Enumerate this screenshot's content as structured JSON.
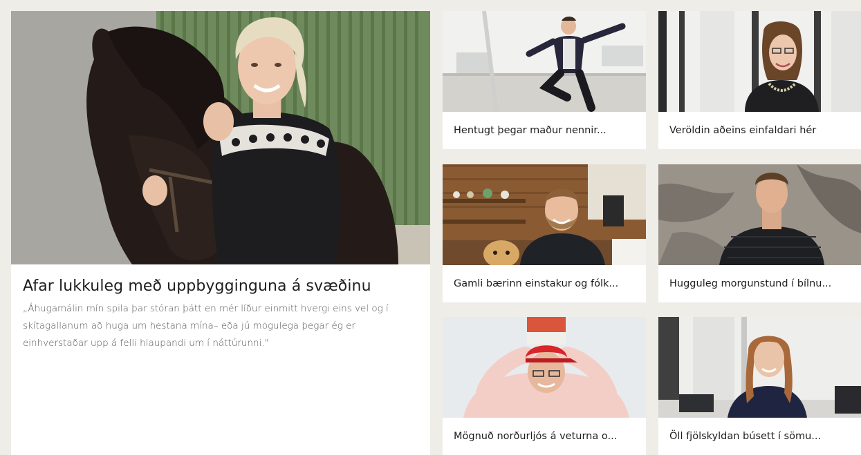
{
  "feature": {
    "title": "Afar lukkuleg með uppbygginguna á svæðinu",
    "quote": "„Áhugamálin mín spila þar stóran þátt en mér líður einmitt hvergi eins vel og í skítagallanum að huga um hestana mína– eða jú mögulega þegar ég er einhverstaðar upp á felli hlaupandi um í náttúrunni.\""
  },
  "cards": [
    {
      "title": "Hentugt þegar maður nennir..."
    },
    {
      "title": "Veröldin aðeins einfaldari hér"
    },
    {
      "title": "Gamli bærinn einstakur og fólk..."
    },
    {
      "title": "Hugguleg morgunstund í bílnu..."
    },
    {
      "title": "Mögnuð norðurljós á veturna o..."
    },
    {
      "title": "Öll fjölskyldan búsett í sömu..."
    }
  ],
  "colors": {
    "page_bg": "#efede8",
    "card_bg": "#ffffff",
    "title_text": "#1e1e1e",
    "body_text": "#555555"
  }
}
